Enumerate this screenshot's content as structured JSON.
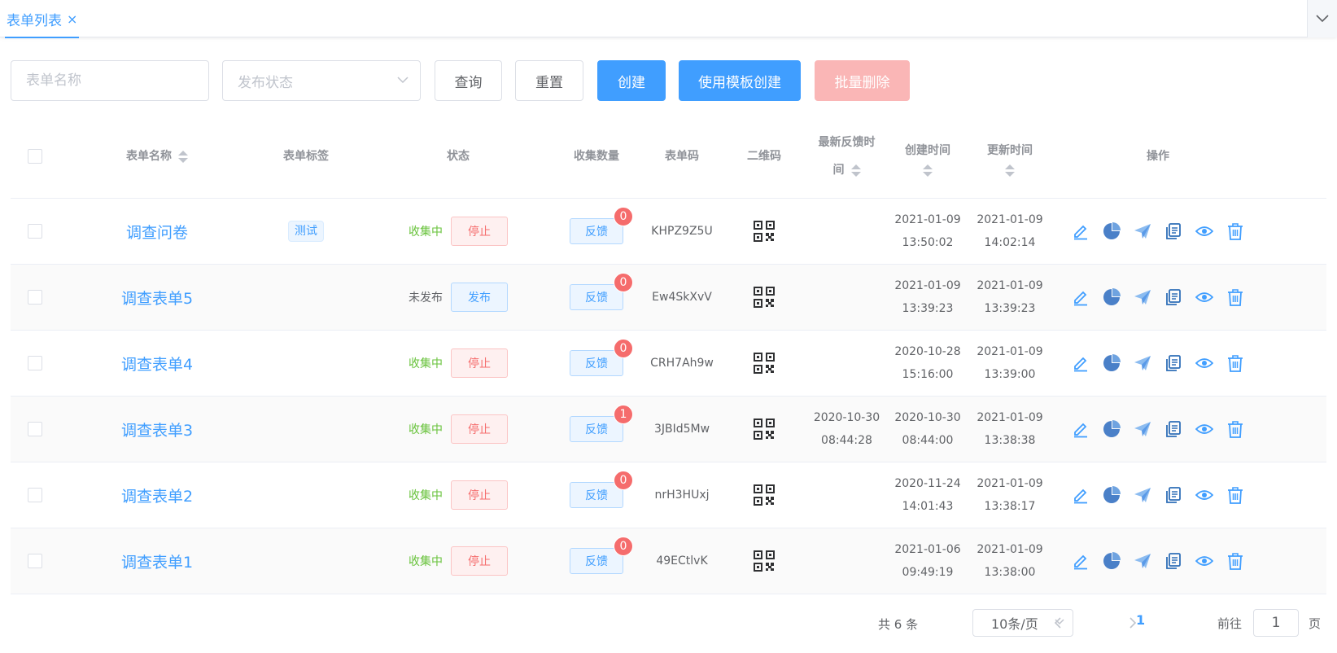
{
  "tabs": [
    {
      "label": "表单列表",
      "close": "×"
    }
  ],
  "search": {
    "name_placeholder": "表单名称",
    "status_placeholder": "发布状态",
    "query_label": "查询",
    "reset_label": "重置",
    "create_label": "创建",
    "template_create_label": "使用模板创建",
    "batch_delete_label": "批量删除"
  },
  "table": {
    "headers": {
      "name": "表单名称",
      "tag": "表单标签",
      "status": "状态",
      "count": "收集数量",
      "code": "表单码",
      "qrcode": "二维码",
      "last_feedback_1": "最新反馈时",
      "last_feedback_2": "间",
      "created": "创建时间",
      "updated": "更新时间",
      "ops": "操作"
    },
    "rows": [
      {
        "name": "调查问卷",
        "tag": "测试",
        "status": "收集中",
        "action": "停止",
        "feedback": "反馈",
        "count": "0",
        "code": "KHPZ9Z5U",
        "last_date": "",
        "last_time": "",
        "created_date": "2021-01-09",
        "created_time": "13:50:02",
        "updated_date": "2021-01-09",
        "updated_time": "14:02:14"
      },
      {
        "name": "调查表单5",
        "tag": "",
        "status": "未发布",
        "action": "发布",
        "feedback": "反馈",
        "count": "0",
        "code": "Ew4SkXvV",
        "last_date": "",
        "last_time": "",
        "created_date": "2021-01-09",
        "created_time": "13:39:23",
        "updated_date": "2021-01-09",
        "updated_time": "13:39:23"
      },
      {
        "name": "调查表单4",
        "tag": "",
        "status": "收集中",
        "action": "停止",
        "feedback": "反馈",
        "count": "0",
        "code": "CRH7Ah9w",
        "last_date": "",
        "last_time": "",
        "created_date": "2020-10-28",
        "created_time": "15:16:00",
        "updated_date": "2021-01-09",
        "updated_time": "13:39:00"
      },
      {
        "name": "调查表单3",
        "tag": "",
        "status": "收集中",
        "action": "停止",
        "feedback": "反馈",
        "count": "1",
        "code": "3JBId5Mw",
        "last_date": "2020-10-30",
        "last_time": "08:44:28",
        "created_date": "2020-10-30",
        "created_time": "08:44:00",
        "updated_date": "2021-01-09",
        "updated_time": "13:38:38"
      },
      {
        "name": "调查表单2",
        "tag": "",
        "status": "收集中",
        "action": "停止",
        "feedback": "反馈",
        "count": "0",
        "code": "nrH3HUxj",
        "last_date": "",
        "last_time": "",
        "created_date": "2020-11-24",
        "created_time": "14:01:43",
        "updated_date": "2021-01-09",
        "updated_time": "13:38:17"
      },
      {
        "name": "调查表单1",
        "tag": "",
        "status": "收集中",
        "action": "停止",
        "feedback": "反馈",
        "count": "0",
        "code": "49ECtlvK",
        "last_date": "",
        "last_time": "",
        "created_date": "2021-01-06",
        "created_time": "09:49:19",
        "updated_date": "2021-01-09",
        "updated_time": "13:38:00"
      }
    ],
    "op_icons": [
      "edit-icon",
      "pie-chart-icon",
      "send-icon",
      "copy-icon",
      "eye-icon",
      "trash-icon"
    ]
  },
  "pagination": {
    "total": "共 6 条",
    "page_size": "10条/页",
    "current_page": "1",
    "goto_label": "前往",
    "goto_value": "1",
    "page_unit": "页"
  },
  "colors": {
    "primary": "#409eff",
    "danger": "#f56c6c",
    "success": "#67c23a",
    "disabled_danger": "#fab6b6"
  }
}
